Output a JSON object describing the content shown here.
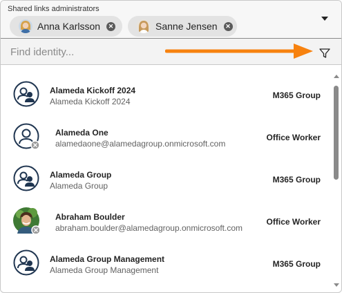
{
  "header": {
    "label": "Shared links administrators",
    "chips": [
      {
        "name": "Anna Karlsson",
        "remove_icon": "dismiss-circle-icon"
      },
      {
        "name": "Sanne Jensen",
        "remove_icon": "dismiss-circle-icon"
      }
    ],
    "dropdown_icon": "caret-down-icon"
  },
  "search": {
    "placeholder": "Find identity...",
    "filter_icon": "filter-icon",
    "arrow_color": "#f7820f"
  },
  "results": [
    {
      "primary": "Alameda Kickoff 2024",
      "secondary": "Alameda Kickoff 2024",
      "type": "M365 Group",
      "avatar": "group-icon"
    },
    {
      "primary": "Alameda One",
      "secondary": "alamedaone@alamedagroup.onmicrosoft.com",
      "type": "Office Worker",
      "avatar": "person-icon"
    },
    {
      "primary": "Alameda Group",
      "secondary": "Alameda Group",
      "type": "M365 Group",
      "avatar": "group-icon"
    },
    {
      "primary": "Abraham Boulder",
      "secondary": "abraham.boulder@alamedagroup.onmicrosoft.com",
      "type": "Office Worker",
      "avatar": "person-photo"
    },
    {
      "primary": "Alameda Group Management",
      "secondary": "Alameda Group Management",
      "type": "M365 Group",
      "avatar": "group-icon"
    }
  ]
}
